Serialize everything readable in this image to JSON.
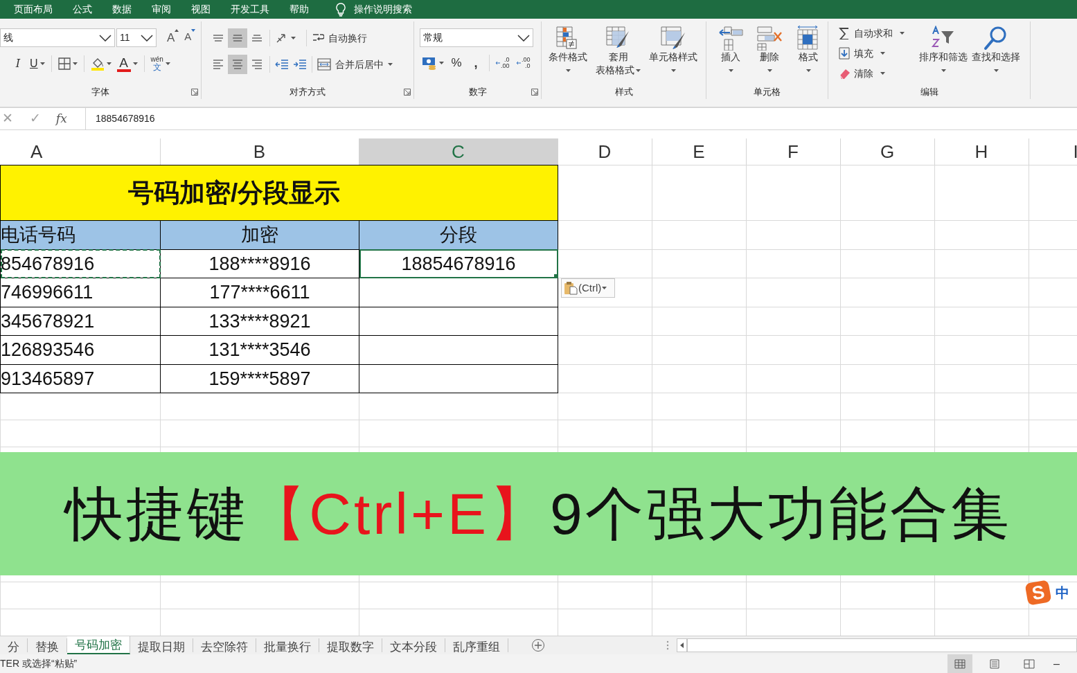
{
  "menu": {
    "items": [
      "页面布局",
      "公式",
      "数据",
      "审阅",
      "视图",
      "开发工具",
      "帮助"
    ],
    "search": "操作说明搜索"
  },
  "ribbon": {
    "font": {
      "name": "线",
      "size": "11",
      "grow": "A",
      "shrink": "A",
      "italic": "I",
      "underline": "U",
      "color_glyph": "A",
      "phonetic_top": "wén",
      "phonetic_bottom": "文",
      "label": "字体"
    },
    "alignment": {
      "vertical": [
        {
          "kind": "top",
          "selected": false
        },
        {
          "kind": "middle",
          "selected": true
        },
        {
          "kind": "bottom",
          "selected": false
        }
      ],
      "horizontal": [
        {
          "kind": "left",
          "selected": false
        },
        {
          "kind": "center",
          "selected": true
        },
        {
          "kind": "right",
          "selected": false
        }
      ],
      "wrap": "自动换行",
      "merge": "合并后居中",
      "label": "对齐方式"
    },
    "number": {
      "format": "常规",
      "percent": "%",
      "comma": ",",
      "increase": [
        ".0",
        ".00"
      ],
      "decrease": [
        ".00",
        ".0"
      ],
      "label": "数字"
    },
    "styles": {
      "buttons": [
        {
          "kind": "conditional",
          "lines": [
            "条件格式"
          ]
        },
        {
          "kind": "table",
          "lines": [
            "套用",
            "表格格式"
          ]
        },
        {
          "kind": "cellstyle",
          "lines": [
            "单元格样式"
          ]
        }
      ],
      "label": "样式"
    },
    "cells": {
      "buttons": [
        {
          "kind": "insert",
          "lines": [
            "插入"
          ]
        },
        {
          "kind": "delete",
          "lines": [
            "删除"
          ]
        },
        {
          "kind": "format",
          "lines": [
            "格式"
          ]
        }
      ],
      "label": "单元格"
    },
    "editing": {
      "small": [
        {
          "kind": "sum",
          "text": "自动求和"
        },
        {
          "kind": "fill",
          "text": "填充"
        },
        {
          "kind": "clear",
          "text": "清除"
        }
      ],
      "buttons": [
        {
          "kind": "sort",
          "lines": [
            "排序和筛选"
          ]
        },
        {
          "kind": "find",
          "lines": [
            "查找和选择"
          ]
        }
      ],
      "label": "编辑"
    }
  },
  "formula_bar": {
    "cancel": "✕",
    "enter": "✓",
    "fx": "fx",
    "value": "18854678916"
  },
  "columns": [
    {
      "label": "A",
      "selected": false
    },
    {
      "label": "B",
      "selected": false
    },
    {
      "label": "C",
      "selected": true
    },
    {
      "label": "D",
      "selected": false
    },
    {
      "label": "E",
      "selected": false
    },
    {
      "label": "F",
      "selected": false
    },
    {
      "label": "G",
      "selected": false
    },
    {
      "label": "H",
      "selected": false
    },
    {
      "label": "I",
      "selected": false
    }
  ],
  "sheet": {
    "title": "号码加密/分段显示",
    "header": [
      "电话号码",
      "加密",
      "分段"
    ],
    "rows": [
      {
        "cells": [
          {
            "text": "854678916",
            "selected": false,
            "copied": true
          },
          {
            "text": "188****8916",
            "selected": false,
            "copied": false
          },
          {
            "text": "18854678916",
            "selected": true,
            "copied": false
          }
        ]
      },
      {
        "cells": [
          {
            "text": "746996611",
            "selected": false,
            "copied": false
          },
          {
            "text": "177****6611",
            "selected": false,
            "copied": false
          },
          {
            "selected": false,
            "copied": false
          }
        ]
      },
      {
        "cells": [
          {
            "text": "345678921",
            "selected": false,
            "copied": false
          },
          {
            "text": "133****8921",
            "selected": false,
            "copied": false
          },
          {
            "selected": false,
            "copied": false
          }
        ]
      },
      {
        "cells": [
          {
            "text": "126893546",
            "selected": false,
            "copied": false
          },
          {
            "text": "131****3546",
            "selected": false,
            "copied": false
          },
          {
            "selected": false,
            "copied": false
          }
        ]
      },
      {
        "cells": [
          {
            "text": "913465897",
            "selected": false,
            "copied": false
          },
          {
            "text": "159****5897",
            "selected": false,
            "copied": false
          },
          {
            "selected": false,
            "copied": false
          }
        ]
      }
    ]
  },
  "paste_options": {
    "label": "(Ctrl)"
  },
  "banner": {
    "segments": [
      {
        "text": "快捷键",
        "color": "#111111"
      },
      {
        "text": "【Ctrl+E】",
        "color": "#e8141c"
      },
      {
        "text": "9个强大功能合集",
        "color": "#111111"
      }
    ]
  },
  "ime": {
    "logo": "S",
    "mode": "中"
  },
  "sheet_tabs": [
    {
      "label": "分",
      "selected": false
    },
    {
      "label": "替换",
      "selected": false
    },
    {
      "label": "号码加密",
      "selected": true
    },
    {
      "label": "提取日期",
      "selected": false
    },
    {
      "label": "去空除符",
      "selected": false
    },
    {
      "label": "批量换行",
      "selected": false
    },
    {
      "label": "提取数字",
      "selected": false
    },
    {
      "label": "文本分段",
      "selected": false
    },
    {
      "label": "乱序重组",
      "selected": false
    }
  ],
  "status": {
    "text": "TER 或选择“粘贴”",
    "views": [
      {
        "kind": "normal",
        "selected": true
      },
      {
        "kind": "layout",
        "selected": false
      },
      {
        "kind": "pagebreak",
        "selected": false
      }
    ],
    "zoom_out": "–"
  }
}
